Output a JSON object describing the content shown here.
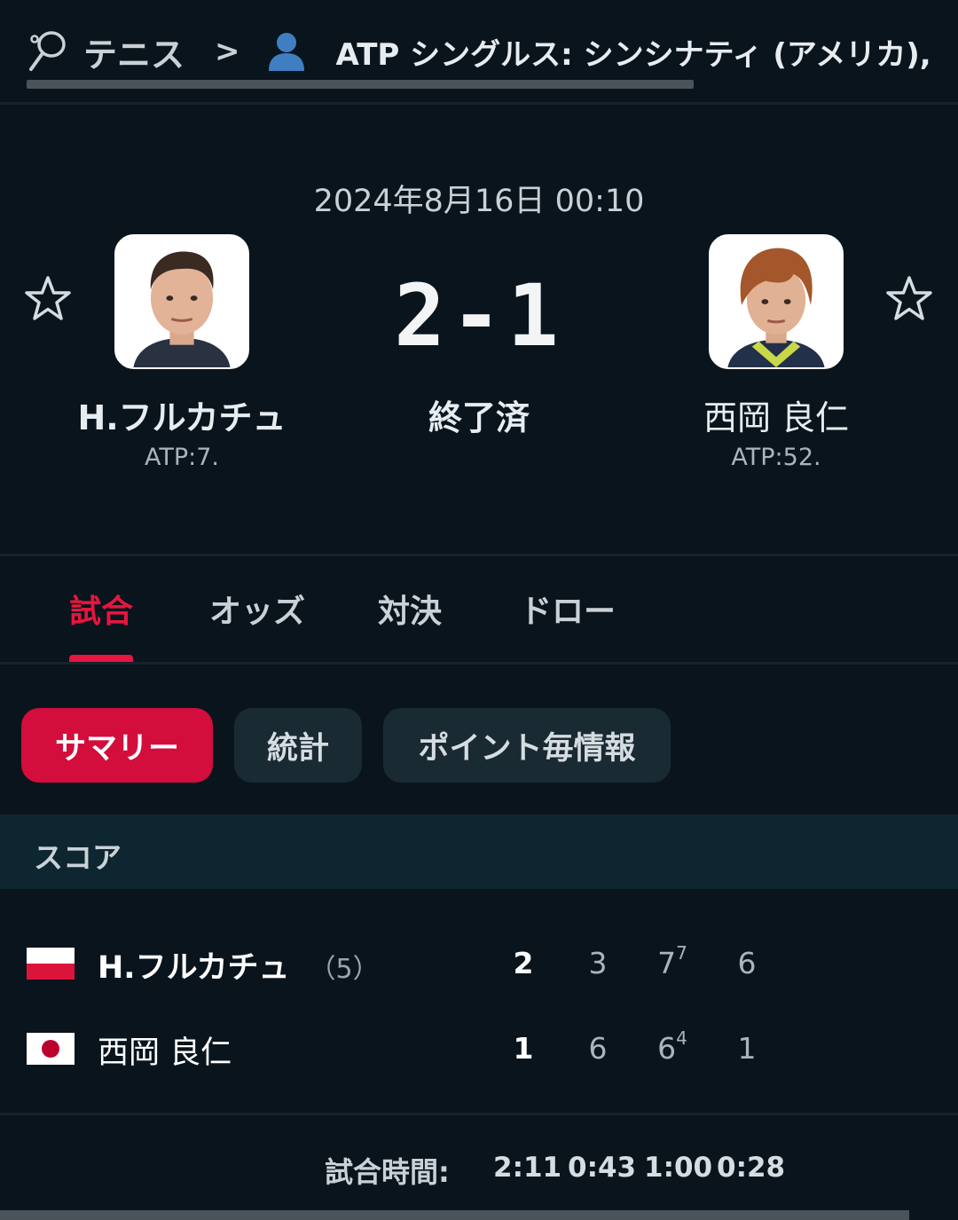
{
  "breadcrumb": {
    "sport": "テニス",
    "separator": ">",
    "tournament": "ATP シングルス: シンシナティ (アメリカ),"
  },
  "match": {
    "datetime": "2024年8月16日 00:10",
    "score": "2-1",
    "status": "終了済",
    "home": {
      "name": "H.フルカチュ",
      "rank": "ATP:7."
    },
    "away": {
      "name": "西岡 良仁",
      "rank": "ATP:52."
    }
  },
  "tabs": [
    "試合",
    "オッズ",
    "対決",
    "ドロー"
  ],
  "active_tab": "試合",
  "subtabs": [
    "サマリー",
    "統計",
    "ポイント毎情報"
  ],
  "active_subtab": "サマリー",
  "score_section": {
    "title": "スコア",
    "rows": [
      {
        "name": "H.フルカチュ",
        "seed": "（5）",
        "flag": "poland",
        "sets": "2",
        "s1": "3",
        "s2": "7",
        "s2_tb": "7",
        "s3": "6"
      },
      {
        "name": "西岡 良仁",
        "seed": "",
        "flag": "japan",
        "sets": "1",
        "s1": "6",
        "s2": "6",
        "s2_tb": "4",
        "s3": "1"
      }
    ]
  },
  "duration": {
    "label": "試合時間:",
    "total": "2:11",
    "sets": [
      "0:43",
      "1:00",
      "0:28"
    ]
  },
  "colors": {
    "accent": "#e5163f",
    "background": "#0a141c",
    "chip": "#1a2a33",
    "section": "#0e2630"
  },
  "icons": [
    "tennis-racket-icon",
    "chevron-right-icon",
    "person-icon",
    "star-icon",
    "poland-flag-icon",
    "japan-flag-icon"
  ]
}
